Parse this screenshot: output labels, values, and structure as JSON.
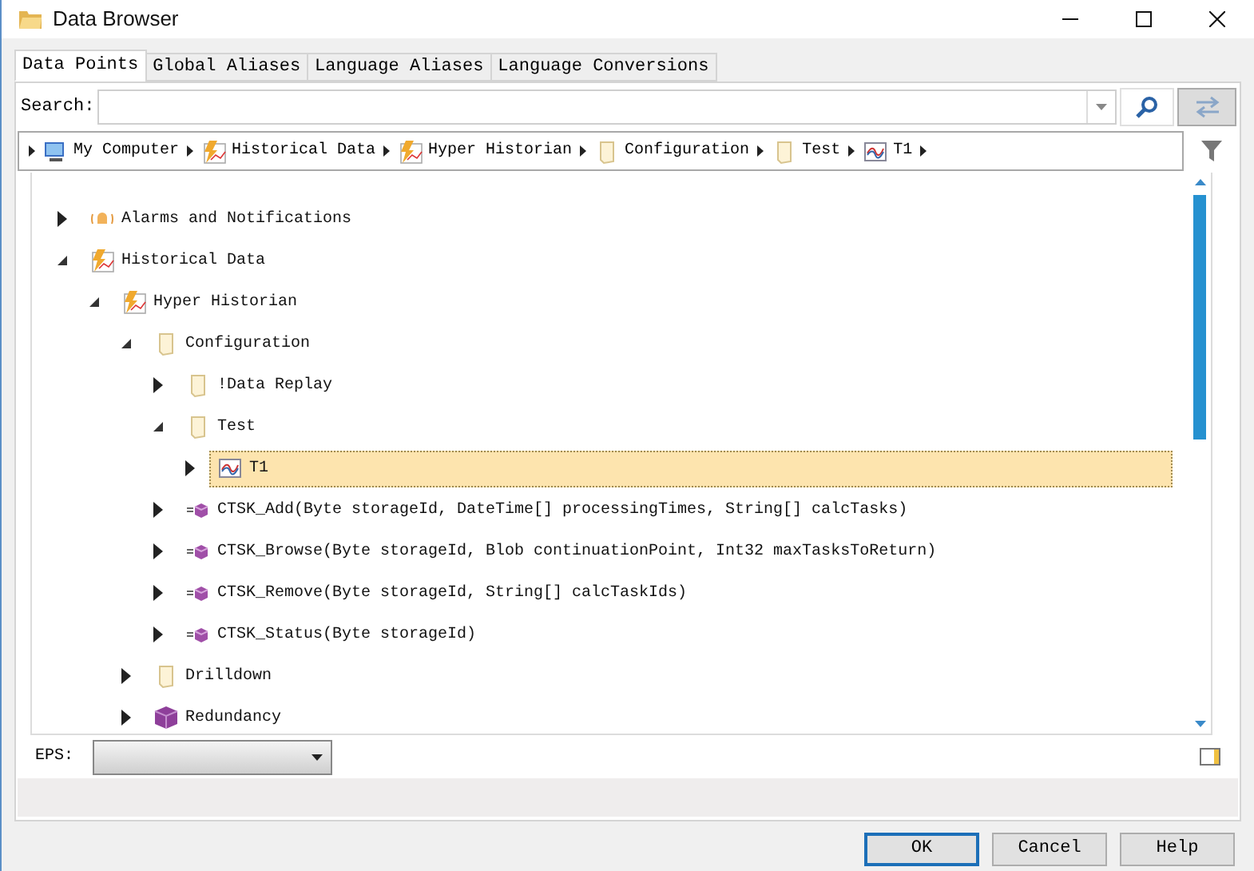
{
  "window": {
    "title": "Data Browser"
  },
  "tabs": [
    {
      "label": "Data Points",
      "selected": true
    },
    {
      "label": "Global Aliases",
      "selected": false
    },
    {
      "label": "Language Aliases",
      "selected": false
    },
    {
      "label": "Language Conversions",
      "selected": false
    }
  ],
  "search": {
    "label": "Search:"
  },
  "breadcrumb": [
    {
      "label": "My Computer",
      "kind": "computer"
    },
    {
      "label": "Historical Data",
      "kind": "historian"
    },
    {
      "label": "Hyper Historian",
      "kind": "historian"
    },
    {
      "label": "Configuration",
      "kind": "folder"
    },
    {
      "label": "Test",
      "kind": "folder"
    },
    {
      "label": "T1",
      "kind": "tag"
    }
  ],
  "tree": [
    {
      "label": "Alarms and Notifications",
      "kind": "alarm",
      "expanded": false,
      "selected": false
    },
    {
      "label": "Historical Data",
      "kind": "historian",
      "expanded": true,
      "selected": false,
      "children": [
        {
          "label": "Hyper Historian",
          "kind": "historian",
          "expanded": true,
          "selected": false,
          "children": [
            {
              "label": "Configuration",
              "kind": "folder",
              "expanded": true,
              "selected": false,
              "children": [
                {
                  "label": "!Data Replay",
                  "kind": "folder",
                  "expanded": false,
                  "selected": false
                },
                {
                  "label": "Test",
                  "kind": "folder",
                  "expanded": true,
                  "selected": false,
                  "children": [
                    {
                      "label": "T1",
                      "kind": "tag",
                      "expanded": false,
                      "selected": true
                    }
                  ]
                },
                {
                  "label": "CTSK_Add(Byte storageId, DateTime[] processingTimes, String[] calcTasks)",
                  "kind": "method",
                  "expanded": false,
                  "selected": false
                },
                {
                  "label": "CTSK_Browse(Byte storageId, Blob continuationPoint, Int32 maxTasksToReturn)",
                  "kind": "method",
                  "expanded": false,
                  "selected": false
                },
                {
                  "label": "CTSK_Remove(Byte storageId, String[] calcTaskIds)",
                  "kind": "method",
                  "expanded": false,
                  "selected": false
                },
                {
                  "label": "CTSK_Status(Byte storageId)",
                  "kind": "method",
                  "expanded": false,
                  "selected": false
                }
              ]
            },
            {
              "label": "Drilldown",
              "kind": "folder",
              "expanded": false,
              "selected": false
            },
            {
              "label": "Redundancy",
              "kind": "cube",
              "expanded": false,
              "selected": false
            }
          ]
        }
      ]
    }
  ],
  "eps": {
    "label": "EPS:"
  },
  "buttons": [
    {
      "label": "OK",
      "default": true
    },
    {
      "label": "Cancel",
      "default": false
    },
    {
      "label": "Help",
      "default": false
    }
  ]
}
